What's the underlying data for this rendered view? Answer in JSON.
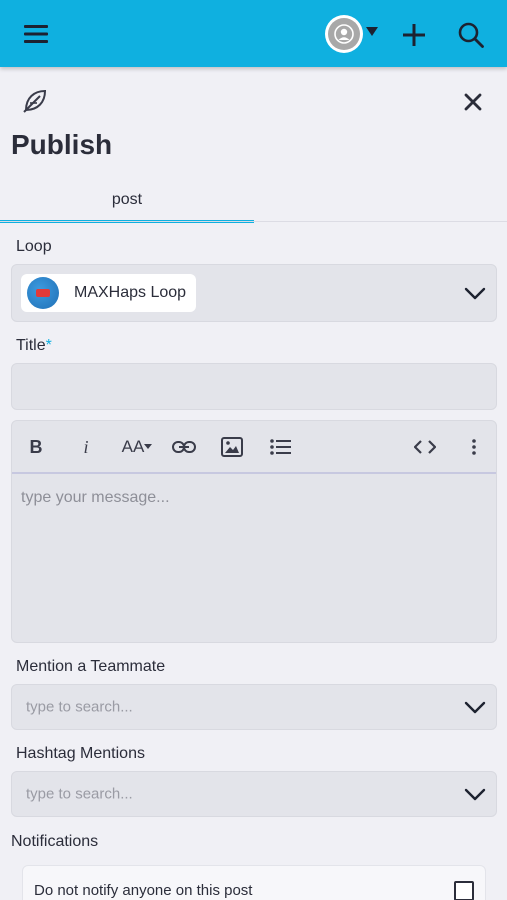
{
  "page": {
    "title": "Publish",
    "tabs": [
      {
        "label": "post"
      }
    ]
  },
  "topbar": {
    "icons": {
      "menu": "hamburger-icon",
      "avatar": "user-icon",
      "add": "plus-icon",
      "search": "search-icon"
    },
    "accent_color": "#0fb0e0"
  },
  "form": {
    "loop_label": "Loop",
    "loop_value": "MAXHaps Loop",
    "title_label": "Title",
    "title_required_mark": "*",
    "title_value": "",
    "editor": {
      "toolbar": [
        "bold",
        "italic",
        "font-size",
        "link",
        "image",
        "bulleted-list",
        "code",
        "more"
      ],
      "bold_glyph": "B",
      "italic_glyph": "i",
      "fontsize_glyph": "AA",
      "placeholder": "type your message..."
    },
    "mention_label": "Mention a Teammate",
    "mention_placeholder": "type to search...",
    "hashtag_label": "Hashtag Mentions",
    "hashtag_placeholder": "type to search...",
    "notifications_label": "Notifications",
    "notify_option": "Do not notify anyone on this post",
    "notify_checked": false
  }
}
